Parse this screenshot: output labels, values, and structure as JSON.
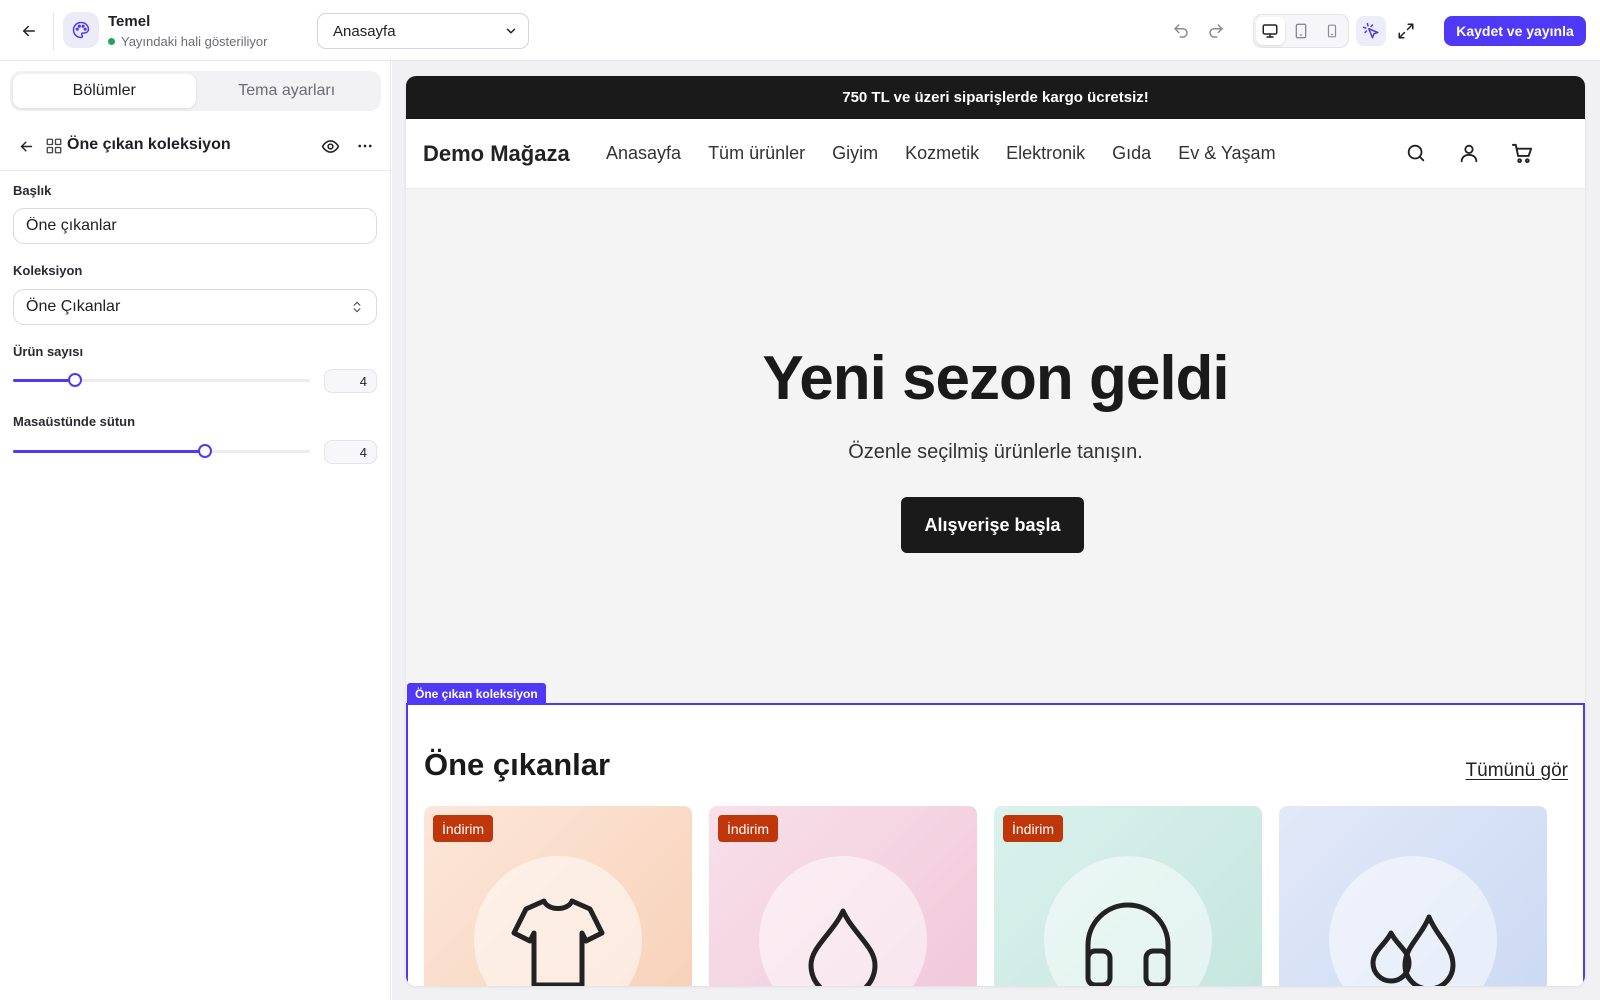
{
  "topbar": {
    "theme_name": "Temel",
    "theme_status": "Yayındaki hali gösteriliyor",
    "page_select_value": "Anasayfa",
    "publish_label": "Kaydet ve yayınla",
    "active_device": "desktop"
  },
  "sidebar": {
    "tabs": [
      {
        "label": "Bölümler",
        "active": true
      },
      {
        "label": "Tema ayarları",
        "active": false
      }
    ],
    "section_title": "Öne çıkan koleksiyon",
    "fields": {
      "title_label": "Başlık",
      "title_value": "Öne çıkanlar",
      "collection_label": "Koleksiyon",
      "collection_value": "Öne Çıkanlar",
      "product_count_label": "Ürün sayısı",
      "product_count_value": "4",
      "columns_label": "Masaüstünde sütun",
      "columns_value": "4"
    }
  },
  "preview": {
    "announcement": "750 TL ve üzeri siparişlerde kargo ücretsiz!",
    "store_name": "Demo Mağaza",
    "nav": [
      "Anasayfa",
      "Tüm ürünler",
      "Giyim",
      "Kozmetik",
      "Elektronik",
      "Gıda",
      "Ev & Yaşam"
    ],
    "hero": {
      "title": "Yeni sezon geldi",
      "subtitle": "Özenle seçilmiş ürünlerle tanışın.",
      "button": "Alışverişe başla"
    },
    "selected_section_tag": "Öne çıkan koleksiyon",
    "featured": {
      "title": "Öne çıkanlar",
      "view_all": "Tümünü gör",
      "cards": [
        {
          "icon": "tshirt-icon",
          "badge": "İndirim",
          "bg_from": "#fde7da",
          "bg_to": "#f7d1b8"
        },
        {
          "icon": "drop-icon",
          "badge": "İndirim",
          "bg_from": "#f8e0ea",
          "bg_to": "#f1c8d9"
        },
        {
          "icon": "headphones-icon",
          "badge": "İndirim",
          "bg_from": "#daf1ec",
          "bg_to": "#c5e6de"
        },
        {
          "icon": "drops-icon",
          "badge": "",
          "bg_from": "#e2e9f8",
          "bg_to": "#cbd9f3"
        }
      ]
    }
  },
  "colors": {
    "accent": "#4f39f6",
    "badge": "#c0360b",
    "status_green": "#22a55a",
    "announcement_bg": "#1a1a1a"
  }
}
